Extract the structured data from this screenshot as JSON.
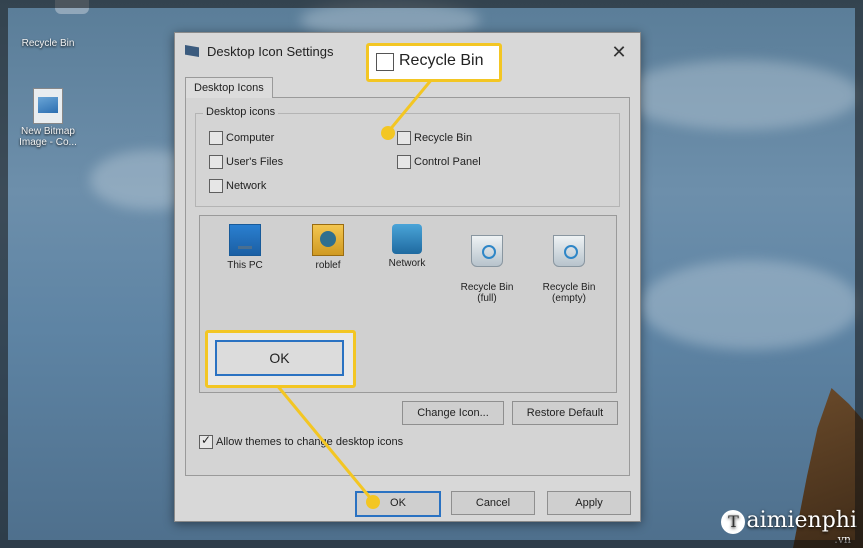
{
  "desktop": {
    "icons": [
      {
        "label": "Recycle Bin"
      },
      {
        "label": "New Bitmap Image - Co..."
      }
    ]
  },
  "dialog": {
    "title": "Desktop Icon Settings",
    "close_glyph": "✕",
    "tab_label": "Desktop Icons",
    "group_title": "Desktop icons",
    "checkboxes": [
      {
        "label": "Computer",
        "checked": false
      },
      {
        "label": "User's Files",
        "checked": false
      },
      {
        "label": "Network",
        "checked": false
      },
      {
        "label": "Recycle Bin",
        "checked": false
      },
      {
        "label": "Control Panel",
        "checked": false
      }
    ],
    "icon_list": [
      {
        "label": "This PC",
        "icon": "computer-icon"
      },
      {
        "label": "roblef",
        "icon": "user-folder-icon"
      },
      {
        "label": "Network",
        "icon": "network-icon"
      },
      {
        "label": "Recycle Bin\n(full)",
        "icon": "recycle-bin-full-icon"
      },
      {
        "label": "Recycle Bin\n(empty)",
        "icon": "recycle-bin-empty-icon"
      }
    ],
    "change_icon_label": "Change Icon...",
    "restore_default_label": "Restore Default",
    "allow_themes_label": "Allow themes to change desktop icons",
    "allow_themes_checked": true,
    "ok_label": "OK",
    "cancel_label": "Cancel",
    "apply_label": "Apply"
  },
  "callouts": {
    "recycle_bin_label": "Recycle Bin",
    "ok_label": "OK",
    "color": "#f3c623"
  },
  "watermark": {
    "logo_letter": "T",
    "brand": "aimienphi",
    "suffix": ".vn"
  }
}
